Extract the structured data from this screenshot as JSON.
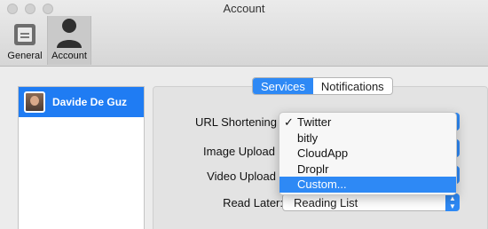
{
  "window": {
    "title": "Account"
  },
  "toolbar": {
    "general_label": "General",
    "account_label": "Account"
  },
  "accounts": [
    {
      "name": "Davide De Guz"
    }
  ],
  "tabs": {
    "services": "Services",
    "notifications": "Notifications"
  },
  "form": {
    "url_shortening_label": "URL Shortening",
    "image_upload_label": "Image Upload",
    "video_upload_label": "Video Upload",
    "read_later_label": "Read Later:",
    "read_later_value": "Reading List"
  },
  "menu": {
    "items": [
      "Twitter",
      "bitly",
      "CloudApp",
      "Droplr",
      "Custom..."
    ],
    "checked": "Twitter",
    "highlighted": "Custom..."
  },
  "colors": {
    "accent": "#2e89f5",
    "selection": "#1f7cf3"
  }
}
